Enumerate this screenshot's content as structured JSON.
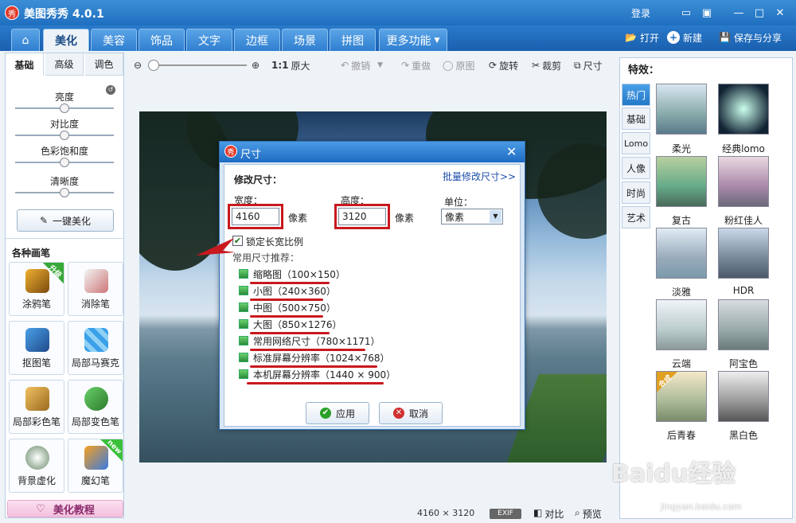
{
  "app": {
    "title": "美图秀秀 4.0.1",
    "login": "登录"
  },
  "tabs": [
    {
      "label": "美化",
      "active": true
    },
    {
      "label": "美容"
    },
    {
      "label": "饰品"
    },
    {
      "label": "文字"
    },
    {
      "label": "边框"
    },
    {
      "label": "场景"
    },
    {
      "label": "拼图"
    },
    {
      "label": "更多功能"
    }
  ],
  "top_actions": {
    "open": "打开",
    "new": "新建",
    "save": "保存与分享"
  },
  "left": {
    "subtabs": [
      "基础",
      "高级",
      "调色"
    ],
    "sliders": [
      "亮度",
      "对比度",
      "色彩饱和度",
      "清晰度"
    ],
    "one_click": "一键美化",
    "brushes_title": "各种画笔",
    "brushes": [
      {
        "label": "涂鸦笔",
        "badge": "升级"
      },
      {
        "label": "消除笔"
      },
      {
        "label": "抠图笔"
      },
      {
        "label": "局部马赛克"
      },
      {
        "label": "局部彩色笔"
      },
      {
        "label": "局部变色笔"
      },
      {
        "label": "背景虚化"
      },
      {
        "label": "魔幻笔",
        "badge": "new"
      }
    ],
    "tutorial": "美化教程"
  },
  "toolbar": {
    "ratio": "1:1",
    "original_size": "原大",
    "undo": "撤销",
    "redo": "重做",
    "original": "原图",
    "rotate": "旋转",
    "crop": "裁剪",
    "size": "尺寸"
  },
  "dialog": {
    "title": "尺寸",
    "heading": "修改尺寸：",
    "batch_link": "批量修改尺寸>>",
    "width_label": "宽度：",
    "width_value": "4160",
    "px1": "像素",
    "height_label": "高度：",
    "height_value": "3120",
    "px2": "像素",
    "unit_label": "单位：",
    "unit_value": "像素",
    "lock_label": "锁定长宽比例",
    "presets_label": "常用尺寸推荐：",
    "presets": [
      "缩略图（100×150）",
      "小图（240×360）",
      "中图（500×750）",
      "大图（850×1276）",
      "常用网络尺寸（780×1171）",
      "标准屏幕分辨率（1024×768）",
      "本机屏幕分辨率（1440 × 900）"
    ],
    "apply": "应用",
    "cancel": "取消"
  },
  "status": {
    "dimensions": "4160 × 3120",
    "exif": "EXIF",
    "compare": "对比",
    "preview": "预览"
  },
  "effects": {
    "title": "特效：",
    "categories": [
      "热门",
      "基础",
      "Lomo",
      "人像",
      "时尚",
      "艺术"
    ],
    "items": [
      "柔光",
      "经典lomo",
      "复古",
      "粉红佳人",
      "淡雅",
      "HDR",
      "云端",
      "阿宝色",
      "后青春",
      "黑白色"
    ],
    "badge": "合成"
  },
  "watermark": {
    "brand": "Baidu经验",
    "url": "jingyan.baidu.com"
  }
}
